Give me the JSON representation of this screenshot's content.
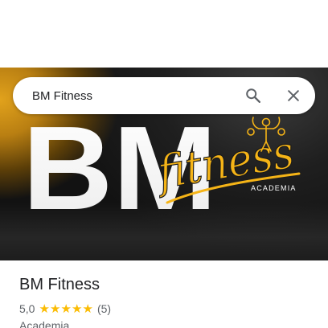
{
  "search": {
    "value": "BM Fitness",
    "placeholder": ""
  },
  "hero": {
    "logo_initials": "BM",
    "logo_script": "fitness",
    "logo_subtitle": "ACADEMIA",
    "accent_color": "#f5b417"
  },
  "place": {
    "name": "BM Fitness",
    "rating": "5,0",
    "stars": 5,
    "reviews": "(5)",
    "category": "Academia"
  },
  "icons": {
    "search": "search-icon",
    "close": "close-icon",
    "star": "star-icon",
    "figure": "bodybuilder-icon"
  },
  "colors": {
    "star": "#fbbc04",
    "text_primary": "#202124",
    "text_secondary": "#5f6368",
    "icon": "#5f6368"
  }
}
